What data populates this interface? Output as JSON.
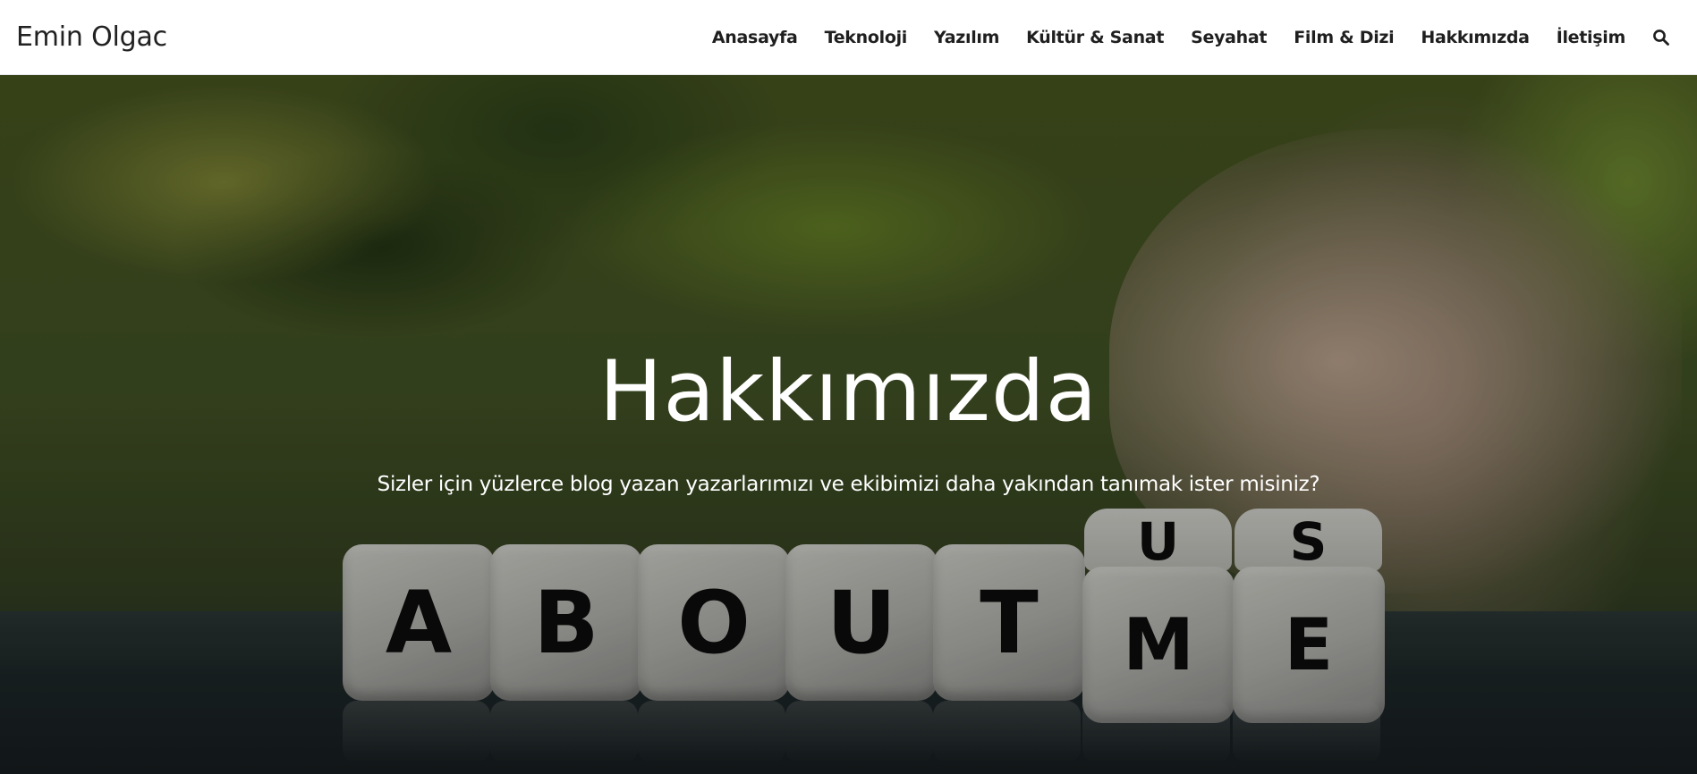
{
  "header": {
    "brand": "Emin Olgac",
    "nav": [
      {
        "label": "Anasayfa"
      },
      {
        "label": "Teknoloji"
      },
      {
        "label": "Yazılım"
      },
      {
        "label": "Kültür & Sanat"
      },
      {
        "label": "Seyahat"
      },
      {
        "label": "Film & Dizi"
      },
      {
        "label": "Hakkımızda"
      },
      {
        "label": "İletişim"
      }
    ],
    "search_icon": "search-icon"
  },
  "hero": {
    "title": "Hakkımızda",
    "subtitle": "Sizler için yüzlerce blog yazan yazarlarımızı ve ekibimizi daha yakından tanımak ister misiniz?",
    "dice": [
      "A",
      "B",
      "O",
      "U",
      "T",
      "M",
      "E"
    ],
    "dice_top": [
      "U",
      "S"
    ]
  }
}
